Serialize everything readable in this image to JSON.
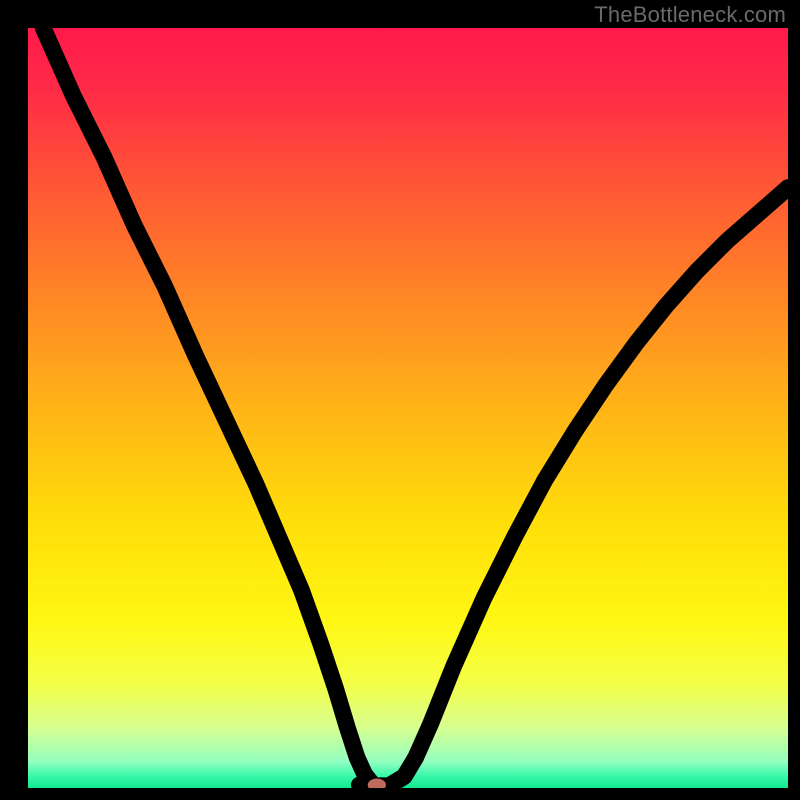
{
  "watermark": "TheBottleneck.com",
  "gradient": {
    "stops": [
      {
        "offset": 0.0,
        "color": "#ff1a4b"
      },
      {
        "offset": 0.08,
        "color": "#ff2a47"
      },
      {
        "offset": 0.2,
        "color": "#ff5436"
      },
      {
        "offset": 0.35,
        "color": "#ff8526"
      },
      {
        "offset": 0.5,
        "color": "#ffb417"
      },
      {
        "offset": 0.65,
        "color": "#ffde0a"
      },
      {
        "offset": 0.78,
        "color": "#fff713"
      },
      {
        "offset": 0.86,
        "color": "#f4ff45"
      },
      {
        "offset": 0.92,
        "color": "#d8ff8f"
      },
      {
        "offset": 0.965,
        "color": "#93ffc1"
      },
      {
        "offset": 0.985,
        "color": "#35f7a8"
      },
      {
        "offset": 1.0,
        "color": "#13e890"
      }
    ]
  },
  "chart_data": {
    "type": "line",
    "title": "",
    "xlabel": "",
    "ylabel": "",
    "xlim": [
      0,
      100
    ],
    "ylim": [
      0,
      100
    ],
    "series": [
      {
        "name": "curve",
        "x": [
          2,
          6,
          10,
          14,
          18,
          22,
          26,
          30,
          33,
          36,
          38.5,
          40.5,
          42,
          43.3,
          44.3,
          45.5,
          47.5,
          49.5,
          51,
          53,
          56,
          60,
          64,
          68,
          72,
          76,
          80,
          84,
          88,
          92,
          96,
          100
        ],
        "y": [
          100,
          91,
          83,
          74,
          66,
          57,
          48.5,
          40,
          33,
          26,
          19,
          13,
          8,
          4,
          1.8,
          0.3,
          0.3,
          1.5,
          4,
          8.5,
          16,
          25,
          33,
          40.5,
          47,
          53,
          58.5,
          63.5,
          68,
          72,
          75.5,
          79
        ]
      }
    ],
    "marker": {
      "x": 45.9,
      "y": 0.4,
      "rx": 1.2,
      "ry": 0.85
    },
    "notch": {
      "x_start": 43.6,
      "x_end": 45.5,
      "y": 0.4
    }
  }
}
